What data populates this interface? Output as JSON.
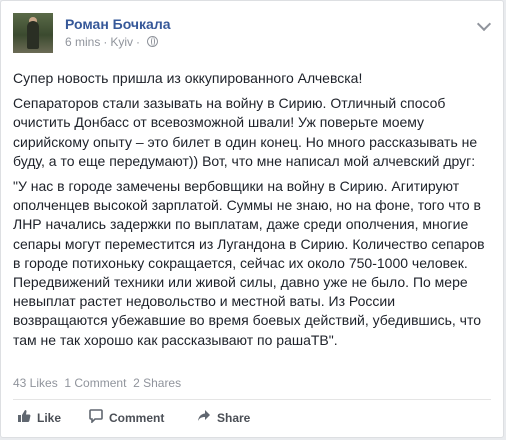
{
  "post": {
    "author": "Роман Бочкала",
    "time": "6 mins",
    "location": "Kyiv",
    "separator": "·",
    "paragraphs": [
      "Супер новость пришла из оккупированного Алчевска!",
      "Сепараторов стали зазывать на войну в Сирию. Отличный способ очистить Донбасс от всевозможной швали! Уж поверьте моему сирийскому опыту – это билет в один конец. Но много рассказывать не буду, а то еще передумают)) Вот, что мне написал мой алчевский друг:",
      "\"У нас в городе замечены вербовщики на войну в Сирию. Агитируют ополченцев высокой зарплатой. Суммы не знаю, но на фоне, того что в ЛНР начались задержки по выплатам, даже среди ополчения, многие сепары могут переместится из Лугандона в Сирию. Количество сепаров в городе потихоньку сокращается, сейчас их около 750-1000 человек. Передвижений техники или живой силы, давно уже не было. По мере невыплат растет недовольство и местной ваты. Из России возвращаются убежавшие во время боевых действий, убедившись, что там не так хорошо как рассказывают по рашаТВ\"."
    ]
  },
  "stats": {
    "likes": "43 Likes",
    "comments": "1 Comment",
    "shares": "2 Shares"
  },
  "actions": {
    "like": "Like",
    "comment": "Comment",
    "share": "Share"
  },
  "icons": {
    "privacy": "globe-icon",
    "menu": "chevron-down-icon",
    "like": "thumbs-up-icon",
    "comment": "speech-bubble-icon",
    "share": "share-arrow-icon"
  },
  "colors": {
    "link": "#365899",
    "text": "#1d2129",
    "meta": "#90949c",
    "action": "#4b4f56"
  }
}
